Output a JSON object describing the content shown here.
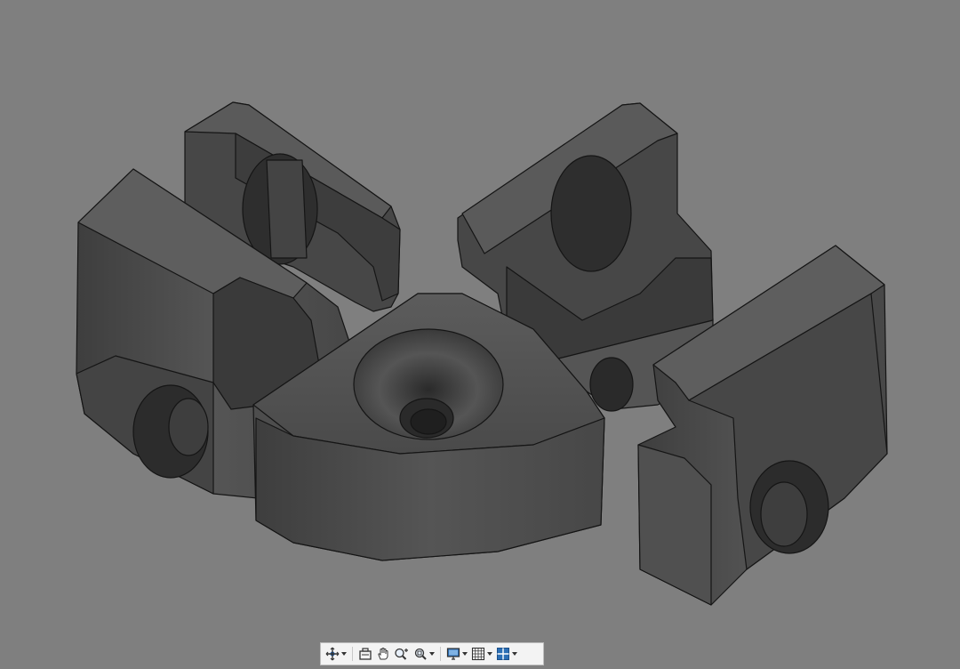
{
  "canvas": {
    "background_color": "#7f7f7f",
    "model_color": "#4a4a4a",
    "edge_color": "#111111"
  },
  "toolbar": {
    "buttons": [
      {
        "name": "orbit-tool",
        "icon": "orbit-icon",
        "has_dropdown": true
      },
      {
        "name": "look-at-tool",
        "icon": "look-at-icon",
        "has_dropdown": false
      },
      {
        "name": "pan-tool",
        "icon": "hand-pan-icon",
        "has_dropdown": false
      },
      {
        "name": "zoom-tool",
        "icon": "zoom-plus-icon",
        "has_dropdown": false
      },
      {
        "name": "fit-tool",
        "icon": "zoom-window-icon",
        "has_dropdown": true
      },
      {
        "name": "display-settings-tool",
        "icon": "monitor-icon",
        "has_dropdown": true
      },
      {
        "name": "grid-settings-tool",
        "icon": "grid-icon",
        "has_dropdown": true
      },
      {
        "name": "viewports-tool",
        "icon": "viewports-icon",
        "has_dropdown": true
      }
    ]
  }
}
